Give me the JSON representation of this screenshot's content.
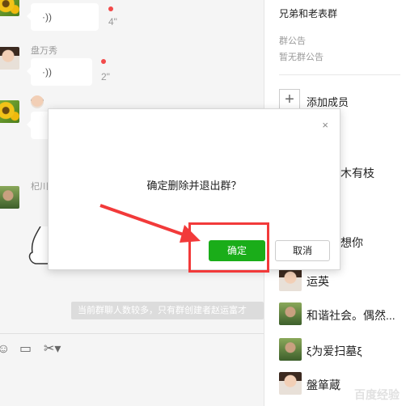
{
  "chat": {
    "messages": [
      {
        "sender": "",
        "duration": "4\"",
        "voice": "·))"
      },
      {
        "sender": "盘万秀",
        "duration": "2\"",
        "voice": "·))"
      },
      {
        "sender": "",
        "duration": "",
        "voice": ""
      },
      {
        "sender": "杞川",
        "duration": "",
        "voice": ""
      }
    ],
    "tip": "当前群聊人数较多，只有群创建者赵运富才"
  },
  "panel": {
    "group_name": "兄弟和老表群",
    "notice_label": "群公告",
    "notice_value": "暂无群公告",
    "add_member": "添加成员",
    "members": [
      {
        "name": "木兮木有枝"
      },
      {
        "name": "想你"
      },
      {
        "name": "运英"
      },
      {
        "name": "和谐社会。偶然..."
      },
      {
        "name": "ξ为爱扫墓ξ"
      },
      {
        "name": "盤箪蔵"
      }
    ]
  },
  "dialog": {
    "message": "确定删除并退出群？",
    "ok_label": "确定",
    "cancel_label": "取消",
    "close_glyph": "×"
  },
  "toolbar": {
    "emoji": "☺",
    "folder": "▭",
    "scissors": "✂▾"
  },
  "watermark": "百度经验",
  "colors": {
    "accent_green": "#1aad19",
    "annotation_red": "#f23a3a",
    "unread_dot": "#f24a4a"
  },
  "icons": [
    "voice-wave-icon",
    "close-icon",
    "plus-icon",
    "emoji-icon",
    "folder-icon",
    "scissors-icon"
  ]
}
